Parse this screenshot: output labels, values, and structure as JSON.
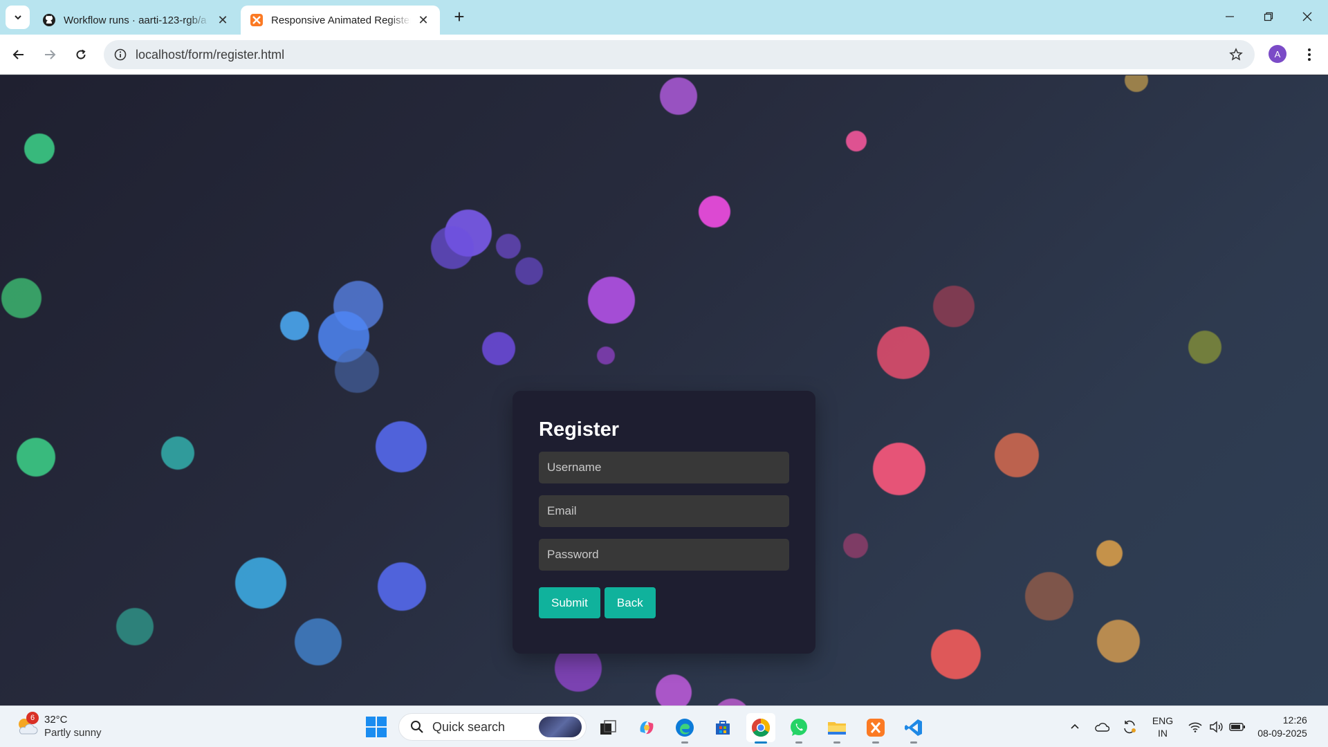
{
  "browser": {
    "tabs": [
      {
        "title": "Workflow runs · aarti-123-rgb/a",
        "favicon": "github-icon",
        "active": false
      },
      {
        "title": "Responsive Animated Register F",
        "favicon": "xampp-icon",
        "active": true
      }
    ],
    "address": "localhost/form/register.html",
    "profile_initial": "A"
  },
  "page": {
    "form": {
      "heading": "Register",
      "username_placeholder": "Username",
      "email_placeholder": "Email",
      "password_placeholder": "Password",
      "submit_label": "Submit",
      "back_label": "Back"
    },
    "colors": {
      "card": "#1e1e30",
      "button": "#10b29c",
      "field": "#383838"
    }
  },
  "taskbar": {
    "weather": {
      "temp": "32°C",
      "desc": "Partly sunny",
      "badge": "6"
    },
    "search_label": "Quick search",
    "apps": [
      "task-view",
      "copilot",
      "edge",
      "store",
      "chrome",
      "whatsapp",
      "file-explorer",
      "xampp",
      "vscode"
    ],
    "lang_line1": "ENG",
    "lang_line2": "IN",
    "time": "12:26",
    "date": "08-09-2025"
  }
}
